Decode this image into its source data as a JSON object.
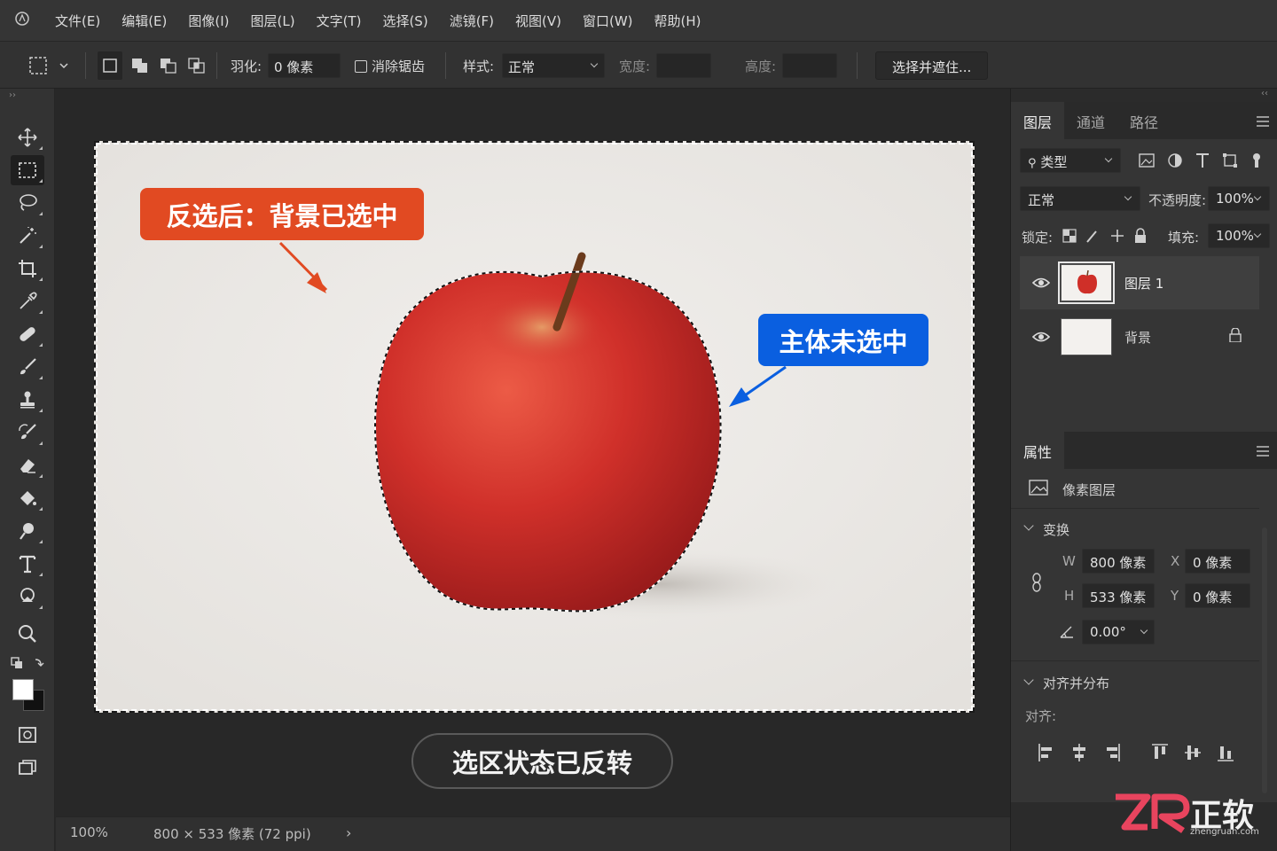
{
  "menubar": {
    "items": [
      "文件(E)",
      "编辑(E)",
      "图像(I)",
      "图层(L)",
      "文字(T)",
      "选择(S)",
      "滤镜(F)",
      "视图(V)",
      "窗口(W)",
      "帮助(H)"
    ]
  },
  "options": {
    "feather_label": "羽化:",
    "feather_value": "0 像素",
    "antialias_label": "消除锯齿",
    "style_label": "样式:",
    "style_value": "正常",
    "width_label": "宽度:",
    "height_label": "高度:",
    "select_mask_button": "选择并遮住..."
  },
  "canvas": {
    "callout_background": "反选后：背景已选中",
    "callout_subject": "主体未选中",
    "status_pill": "选区状态已反转",
    "accent_red": "#e14a22",
    "accent_blue": "#0a5fe0"
  },
  "statusbar": {
    "zoom": "100%",
    "doc_info": "800 × 533 像素 (72 ppi)"
  },
  "layers_panel": {
    "tabs": [
      "图层",
      "通道",
      "路径"
    ],
    "filter_label": "类型",
    "blend_mode": "正常",
    "opacity_label": "不透明度:",
    "opacity_value": "100%",
    "lock_label": "锁定:",
    "fill_label": "填充:",
    "fill_value": "100%",
    "layers": [
      {
        "name": "图层 1",
        "selected": true
      },
      {
        "name": "背景",
        "locked": true
      }
    ]
  },
  "properties_panel": {
    "title": "属性",
    "layer_type": "像素图层",
    "transform_title": "变换",
    "w_label": "W",
    "w_value": "800 像素",
    "h_label": "H",
    "h_value": "533 像素",
    "x_label": "X",
    "x_value": "0 像素",
    "y_label": "Y",
    "y_value": "0 像素",
    "angle_value": "0.00°",
    "align_title": "对齐并分布",
    "align_label": "对齐:"
  },
  "watermark": {
    "brand": "正软",
    "domain": "zhengruan.com"
  }
}
